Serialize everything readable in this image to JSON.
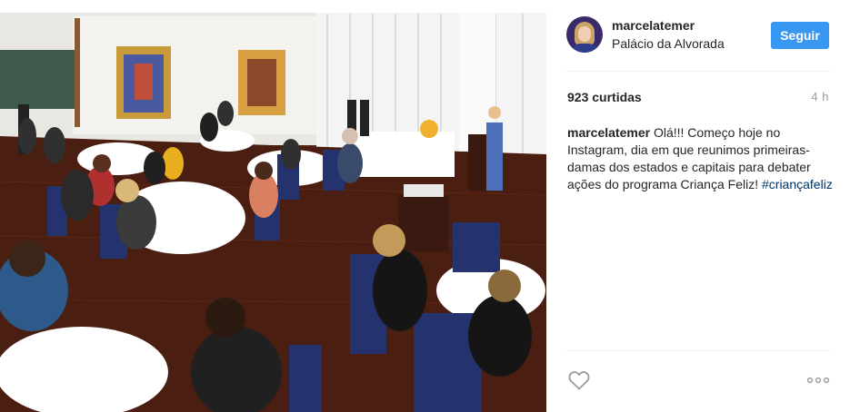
{
  "post": {
    "image_alt": "Recepção no salão do Palácio da Alvorada"
  },
  "header": {
    "username": "marcelatemer",
    "location": "Palácio da Alvorada",
    "follow_label": "Seguir"
  },
  "stats": {
    "likes": "923 curtidas",
    "time_ago": "4 h"
  },
  "caption": {
    "user": "marcelatemer",
    "text": "Olá!!! Começo hoje no Instagram, dia em que reunimos primeiras-damas dos estados e capitais para debater ações do programa Criança Feliz!",
    "hashtag": "#criançafeliz"
  },
  "icons": {
    "like": "heart-outline-icon",
    "more": "more-options-icon"
  },
  "colors": {
    "follow_button": "#3897f0",
    "hashtag": "#003569",
    "muted": "#999999",
    "divider": "#efefef"
  }
}
